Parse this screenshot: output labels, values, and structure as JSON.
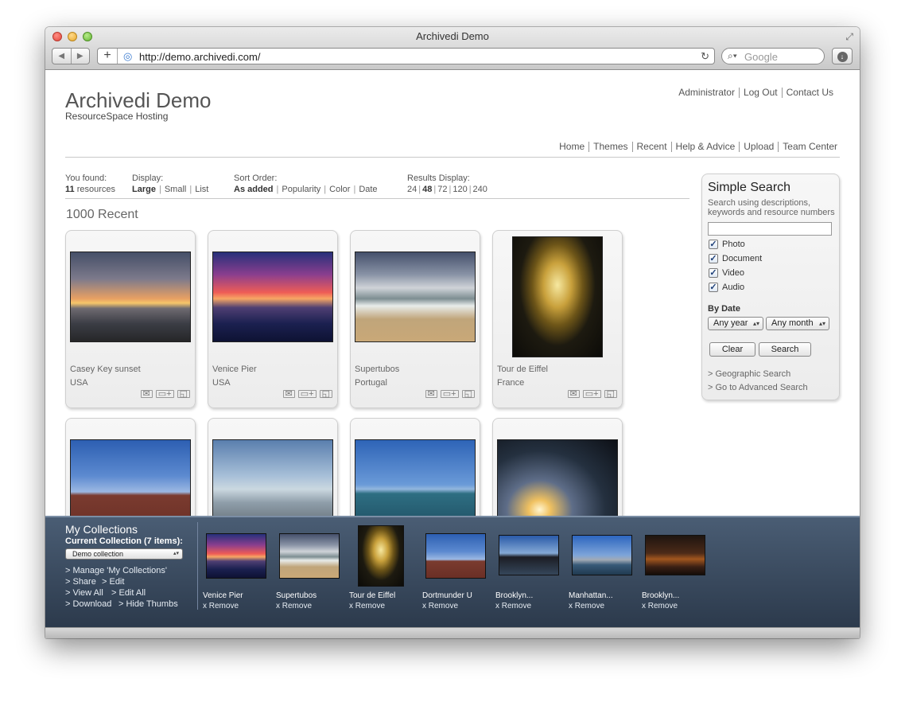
{
  "browser": {
    "window_title": "Archivedi Demo",
    "url": "http://demo.archivedi.com/",
    "search_placeholder": "Google"
  },
  "header": {
    "title": "Archivedi Demo",
    "subtitle": "ResourceSpace Hosting",
    "top_links": [
      "Administrator",
      "Log Out",
      "Contact Us"
    ],
    "nav": [
      "Home",
      "Themes",
      "Recent",
      "Help & Advice",
      "Upload",
      "Team Center"
    ]
  },
  "results": {
    "found_label": "You found:",
    "found_count": "11",
    "found_unit": "resources",
    "display_label": "Display:",
    "display_options": [
      "Large",
      "Small",
      "List"
    ],
    "sort_label": "Sort Order:",
    "sort_options": [
      "As added",
      "Popularity",
      "Color",
      "Date"
    ],
    "per_page_label": "Results Display:",
    "per_page_options": [
      "24",
      "48",
      "72",
      "120",
      "240"
    ],
    "section_title": "1000 Recent"
  },
  "resources": [
    {
      "title": "Casey Key sunset",
      "country": "USA"
    },
    {
      "title": "Venice Pier",
      "country": "USA"
    },
    {
      "title": "Supertubos",
      "country": "Portugal"
    },
    {
      "title": "Tour de Eiffel",
      "country": "France"
    },
    {
      "title": "",
      "country": ""
    },
    {
      "title": "",
      "country": ""
    },
    {
      "title": "",
      "country": ""
    },
    {
      "title": "",
      "country": ""
    }
  ],
  "simple_search": {
    "title": "Simple Search",
    "description": "Search using descriptions, keywords and resource numbers",
    "types": [
      "Photo",
      "Document",
      "Video",
      "Audio"
    ],
    "by_date_label": "By Date",
    "year_select": "Any year",
    "month_select": "Any month",
    "clear_label": "Clear",
    "search_label": "Search",
    "geo_link": "> Geographic Search",
    "advanced_link": "> Go to Advanced Search"
  },
  "collections": {
    "title": "My Collections",
    "current": "Current Collection (7 items):",
    "selected": "Demo collection",
    "manage": "> Manage 'My Collections'",
    "share": "> Share",
    "edit": "> Edit",
    "view_all": "> View All",
    "edit_all": "> Edit All",
    "download": "> Download",
    "hide_thumbs": "> Hide Thumbs",
    "remove_label": "x Remove",
    "items": [
      "Venice Pier",
      "Supertubos",
      "Tour de Eiffel",
      "Dortmunder U",
      "Brooklyn...",
      "Manhattan...",
      "Brooklyn..."
    ]
  },
  "icons": {
    "email": "envelope-icon",
    "add": "add-to-collection-icon",
    "preview": "preview-icon"
  }
}
